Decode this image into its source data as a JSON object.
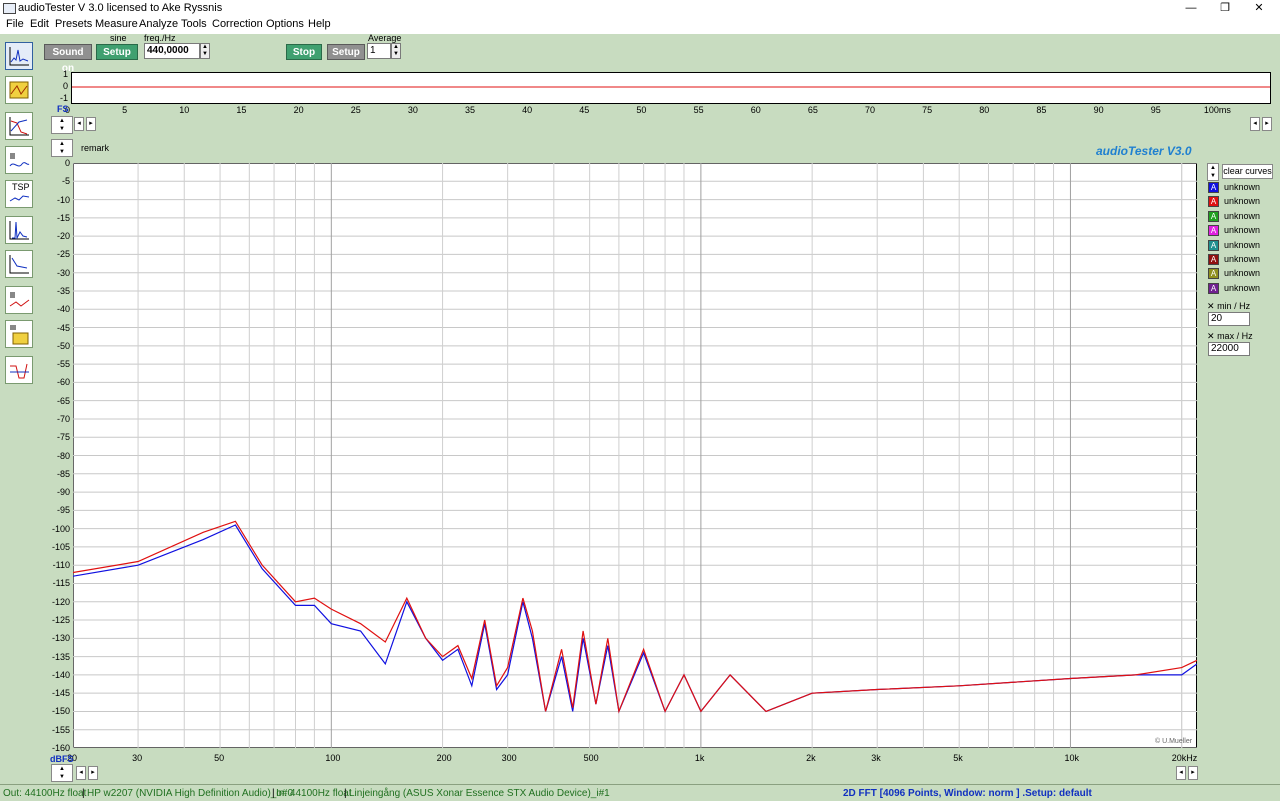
{
  "window": {
    "title": "audioTester  V 3.0   licensed to Ake Ryssnis",
    "minimize": "—",
    "maximize": "❐",
    "close": "✕"
  },
  "menu": [
    "File",
    "Edit",
    "Presets",
    "Measure",
    "Analyze",
    "Tools",
    "Correction",
    "Options",
    "Help"
  ],
  "generator": {
    "sound_on": "Sound on",
    "waveform": "sine",
    "setup": "Setup",
    "freq_label": "freq./Hz",
    "freq_value": "440,0000"
  },
  "analyzer": {
    "stop": "Stop",
    "setup": "Setup",
    "average_label": "Average",
    "average_value": "1"
  },
  "time_plot": {
    "y_ticks": [
      "1",
      "0",
      "-1"
    ],
    "x_ticks": [
      "0",
      "5",
      "10",
      "15",
      "20",
      "25",
      "30",
      "35",
      "40",
      "45",
      "50",
      "55",
      "60",
      "65",
      "70",
      "75",
      "80",
      "85",
      "90",
      "95",
      "100ms"
    ],
    "left_label": "FS"
  },
  "main": {
    "remark": "remark",
    "brand": "audioTester  V3.0",
    "copyright": "© U.Mueller",
    "y_unit": "dBFS",
    "y_ticks": [
      "0",
      "-5",
      "-10",
      "-15",
      "-20",
      "-25",
      "-30",
      "-35",
      "-40",
      "-45",
      "-50",
      "-55",
      "-60",
      "-65",
      "-70",
      "-75",
      "-80",
      "-85",
      "-90",
      "-95",
      "-100",
      "-105",
      "-110",
      "-115",
      "-120",
      "-125",
      "-130",
      "-135",
      "-140",
      "-145",
      "-150",
      "-155",
      "-160"
    ],
    "x_ticks": [
      "20",
      "30",
      "50",
      "100",
      "200",
      "300",
      "500",
      "1k",
      "2k",
      "3k",
      "5k",
      "10k",
      "20kHz"
    ]
  },
  "side": {
    "clear_curves": "clear curves",
    "xmin_label": "min / Hz",
    "xmin_value": "20",
    "xmax_label": "max / Hz",
    "xmax_value": "22000",
    "curves": [
      {
        "letter": "A",
        "name": "unknown",
        "color": "#1010e0"
      },
      {
        "letter": "A",
        "name": "unknown",
        "color": "#e01010"
      },
      {
        "letter": "A",
        "name": "unknown",
        "color": "#20a020"
      },
      {
        "letter": "A",
        "name": "unknown",
        "color": "#e020e0"
      },
      {
        "letter": "A",
        "name": "unknown",
        "color": "#209090"
      },
      {
        "letter": "A",
        "name": "unknown",
        "color": "#901010"
      },
      {
        "letter": "A",
        "name": "unknown",
        "color": "#909020"
      },
      {
        "letter": "A",
        "name": "unknown",
        "color": "#702090"
      }
    ]
  },
  "status": {
    "out": "Out: 44100Hz float",
    "out_dev": "HP w2207 (NVIDIA High Definition Audio)_o#0",
    "in": "In: 44100Hz float",
    "in_dev": "Linjeingång (ASUS Xonar Essence STX Audio Device)_i#1",
    "fft": "2D FFT [4096 Points, Window: norm ] .Setup:  default"
  },
  "chart_data": {
    "type": "line",
    "xlabel": "",
    "ylabel": "dBFS",
    "xscale": "log",
    "xlim": [
      20,
      22000
    ],
    "ylim": [
      -160,
      0
    ],
    "grid": true,
    "series": [
      {
        "name": "blue",
        "color": "#1010e0",
        "x": [
          20,
          30,
          45,
          55,
          65,
          80,
          90,
          100,
          120,
          140,
          160,
          180,
          200,
          220,
          240,
          260,
          280,
          300,
          330,
          350,
          380,
          420,
          450,
          480,
          520,
          560,
          600,
          700,
          800,
          900,
          1000,
          1200,
          1500,
          2000,
          3000,
          5000,
          10000,
          15000,
          20000,
          22000
        ],
        "y": [
          -113,
          -110,
          -103,
          -99,
          -111,
          -121,
          -121,
          -126,
          -128,
          -137,
          -120,
          -130,
          -136,
          -133,
          -143,
          -126,
          -144,
          -140,
          -120,
          -130,
          -150,
          -135,
          -150,
          -130,
          -148,
          -132,
          -150,
          -134,
          -150,
          -140,
          -150,
          -140,
          -150,
          -145,
          -144,
          -143,
          -141,
          -140,
          -140,
          -137
        ]
      },
      {
        "name": "red",
        "color": "#e01010",
        "x": [
          20,
          30,
          45,
          55,
          65,
          80,
          90,
          100,
          120,
          140,
          160,
          180,
          200,
          220,
          240,
          260,
          280,
          300,
          330,
          350,
          380,
          420,
          450,
          480,
          520,
          560,
          600,
          700,
          800,
          900,
          1000,
          1200,
          1500,
          2000,
          3000,
          5000,
          10000,
          15000,
          20000,
          22000
        ],
        "y": [
          -112,
          -109,
          -101,
          -98,
          -110,
          -120,
          -119,
          -122,
          -126,
          -131,
          -119,
          -130,
          -135,
          -132,
          -141,
          -125,
          -143,
          -138,
          -119,
          -128,
          -150,
          -133,
          -149,
          -128,
          -148,
          -130,
          -150,
          -133,
          -150,
          -140,
          -150,
          -140,
          -150,
          -145,
          -144,
          -143,
          -141,
          -140,
          -138,
          -136
        ]
      }
    ]
  }
}
